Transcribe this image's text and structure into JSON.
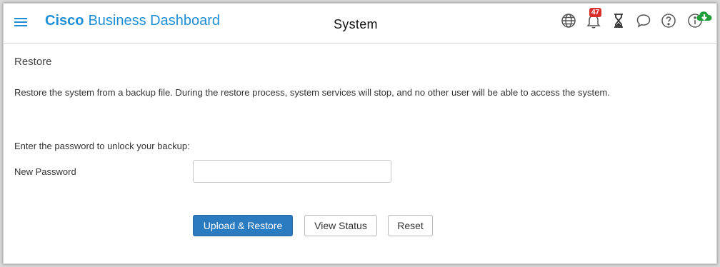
{
  "header": {
    "brand_primary": "Cisco",
    "brand_secondary": "Business Dashboard",
    "title": "System",
    "notification_count": "47",
    "icons": [
      "menu-icon",
      "globe-icon",
      "bell-icon",
      "hourglass-icon",
      "chat-icon",
      "help-icon",
      "info-icon",
      "download-icon"
    ],
    "accent_color": "#1e8fd6",
    "badge_color": "#d9302c",
    "download_badge_color": "#1f9d3a"
  },
  "main": {
    "section_title": "Restore",
    "description": "Restore the system from a backup file. During the restore process, system services will stop, and no other user will be able to access the system.",
    "password_prompt": "Enter the password to unlock your backup:",
    "password_label": "New Password",
    "password_value": "",
    "password_placeholder": ""
  },
  "buttons": {
    "upload_restore": "Upload & Restore",
    "view_status": "View Status",
    "reset": "Reset",
    "primary_color": "#2b7bc0"
  }
}
